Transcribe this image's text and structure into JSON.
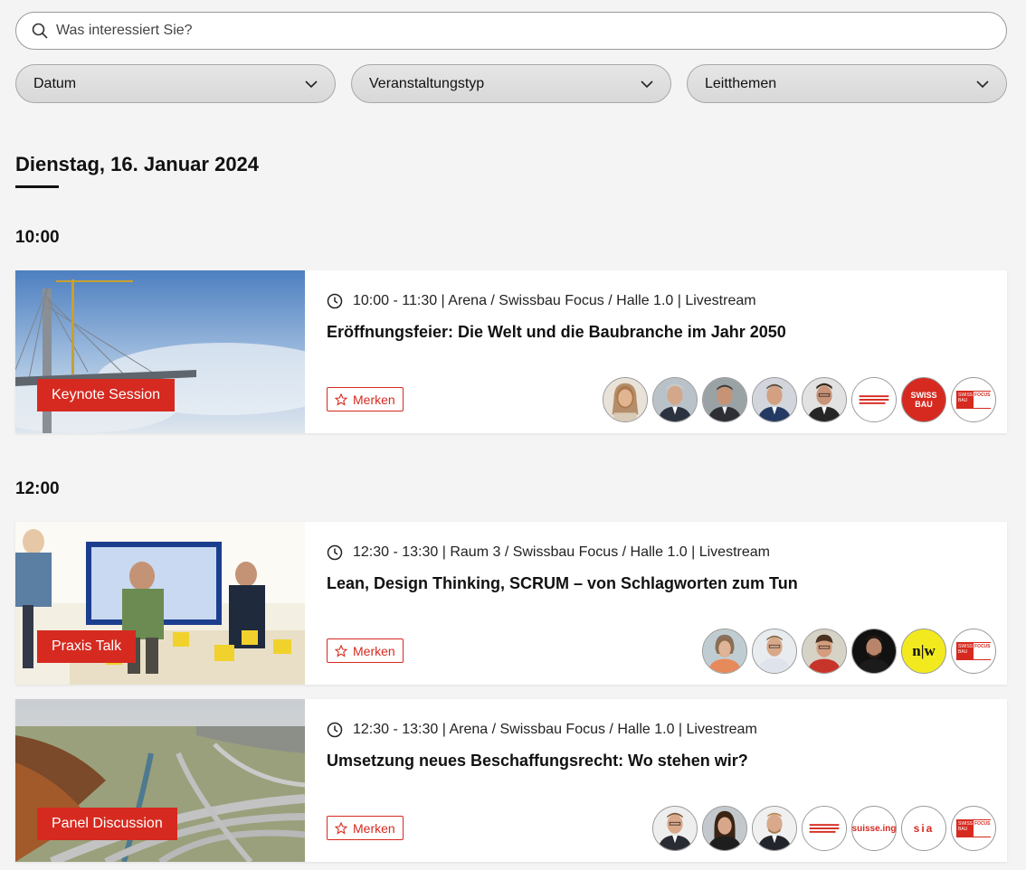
{
  "search": {
    "placeholder": "Was interessiert Sie?"
  },
  "filters": [
    {
      "label": "Datum"
    },
    {
      "label": "Veranstaltungstyp"
    },
    {
      "label": "Leitthemen"
    }
  ],
  "day": {
    "title": "Dienstag, 16. Januar 2024"
  },
  "groups": [
    {
      "time": "10:00"
    },
    {
      "time": "12:00"
    }
  ],
  "events": [
    {
      "tag": "Keynote Session",
      "meta": "10:00 - 11:30 | Arena / Swissbau Focus / Halle 1.0 | Livestream",
      "title": "Eröffnungsfeier: Die Welt und die Baubranche im Jahr 2050",
      "merken": "Merken",
      "logos": {
        "swissbau": "SWISS BAU",
        "focus": "FOCUS"
      }
    },
    {
      "tag": "Praxis Talk",
      "meta": "12:30 - 13:30 | Raum 3 / Swissbau Focus / Halle 1.0 | Livestream",
      "title": "Lean, Design Thinking, SCRUM – von Schlagworten zum Tun",
      "merken": "Merken",
      "logos": {
        "nw": "n|w",
        "focus": "FOCUS"
      }
    },
    {
      "tag": "Panel Discussion",
      "meta": "12:30 - 13:30 | Arena / Swissbau Focus / Halle 1.0 | Livestream",
      "title": "Umsetzung neues Beschaffungsrecht: Wo stehen wir?",
      "merken": "Merken",
      "logos": {
        "suisseing": "suisse.ing",
        "sia": "sia",
        "focus": "FOCUS"
      }
    }
  ],
  "colors": {
    "accent": "#d62a20",
    "background": "#f4f4f4"
  }
}
